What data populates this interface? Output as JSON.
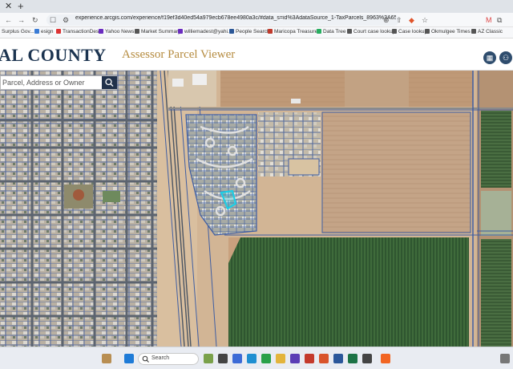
{
  "browser": {
    "url": "experience.arcgis.com/experience/f19ef3d40ed54a979ecb678ee4980a3c/#data_s=id%3AdataSource_1-TaxParcels_8963%3A65425563&zoom_t...",
    "bookmarks": [
      "Surplus Gov...",
      "esign",
      "TransactionDesk",
      "Yahoo News",
      "Market Summary",
      "williemadest@yahi...",
      "People Search",
      "Maricopa Treasure",
      "Data Tree",
      "Court case lookup",
      "Case lookup",
      "Okmulgee Times",
      "AZ Classic"
    ]
  },
  "header": {
    "county": "AL COUNTY",
    "title": "Assessor Parcel Viewer"
  },
  "search": {
    "placeholder": "Parcel, Address or Owner"
  },
  "taskbar": {
    "search_label": "Search"
  }
}
